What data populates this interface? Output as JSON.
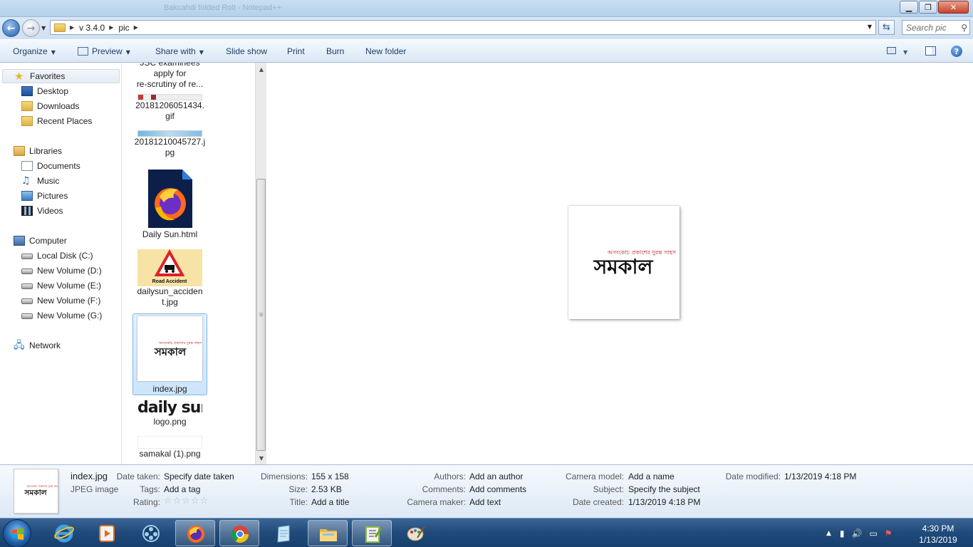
{
  "window": {
    "faint_title": "Bakcahdi folded Rolt - Notepad++"
  },
  "address": {
    "crumbs": [
      "v 3.4.0",
      "pic"
    ],
    "search_placeholder": "Search pic"
  },
  "toolbar": {
    "organize": "Organize",
    "preview": "Preview",
    "share_with": "Share with",
    "slide_show": "Slide show",
    "print": "Print",
    "burn": "Burn",
    "new_folder": "New folder"
  },
  "navpane": {
    "favorites": {
      "label": "Favorites",
      "items": [
        "Desktop",
        "Downloads",
        "Recent Places"
      ]
    },
    "libraries": {
      "label": "Libraries",
      "items": [
        "Documents",
        "Music",
        "Pictures",
        "Videos"
      ]
    },
    "computer": {
      "label": "Computer",
      "items": [
        "Local Disk (C:)",
        "New Volume (D:)",
        "New Volume (E:)",
        "New Volume (F:)",
        "New Volume (G:)"
      ]
    },
    "network": {
      "label": "Network"
    }
  },
  "files": [
    {
      "name_lines": [
        "JSC examinees",
        "apply for",
        "re-scrutiny of re..."
      ]
    },
    {
      "name_lines": [
        "20181206051434.",
        "gif"
      ]
    },
    {
      "name_lines": [
        "20181210045727.j",
        "pg"
      ]
    },
    {
      "name_lines": [
        "Daily Sun.html"
      ]
    },
    {
      "name_lines": [
        "dailysun_acciden",
        "t.jpg"
      ],
      "thumb_text": "Road Accident"
    },
    {
      "name_lines": [
        "index.jpg"
      ],
      "selected": true
    },
    {
      "name_lines": [
        "logo.png"
      ],
      "thumb_text": "daily sun"
    },
    {
      "name_lines": [
        "samakal (1).png"
      ]
    }
  ],
  "logo": {
    "main": "সমকাল",
    "tagline": "অসংকোচ প্রকাশের দুরন্ত সাহস"
  },
  "details": {
    "filename": "index.jpg",
    "filetype": "JPEG image",
    "date_taken_label": "Date taken:",
    "date_taken": "Specify date taken",
    "tags_label": "Tags:",
    "tags": "Add a tag",
    "rating_label": "Rating:",
    "rating_value": 0,
    "rating_max": 5,
    "dimensions_label": "Dimensions:",
    "dimensions": "155 x 158",
    "size_label": "Size:",
    "size": "2.53 KB",
    "title_label": "Title:",
    "title": "Add a title",
    "authors_label": "Authors:",
    "authors": "Add an author",
    "comments_label": "Comments:",
    "comments": "Add comments",
    "camera_maker_label": "Camera maker:",
    "camera_maker": "Add text",
    "camera_model_label": "Camera model:",
    "camera_model": "Add a name",
    "subject_label": "Subject:",
    "subject": "Specify the subject",
    "date_created_label": "Date created:",
    "date_created": "1/13/2019 4:18 PM",
    "date_modified_label": "Date modified:",
    "date_modified": "1/13/2019 4:18 PM"
  },
  "taskbar": {
    "time": "4:30 PM",
    "date": "1/13/2019"
  },
  "colors": {
    "selection": "#cde5fa",
    "taskbar": "#1f4a79",
    "link": "#1e3f66"
  }
}
